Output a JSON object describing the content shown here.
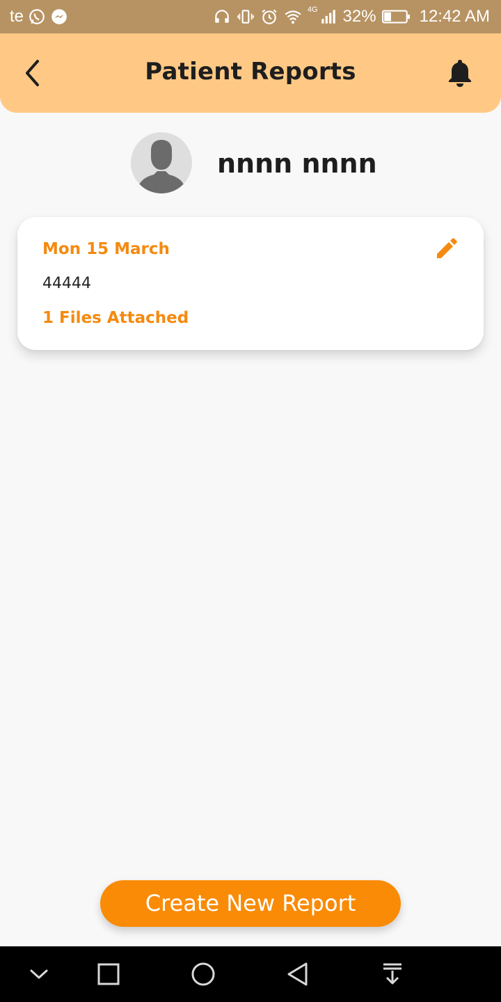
{
  "status_bar": {
    "carrier": "te",
    "network_type": "4G",
    "battery_percent": "32%",
    "battery_level": 0.32,
    "time": "12:42 AM",
    "left_icons": [
      "whatsapp-icon",
      "messenger-icon"
    ],
    "right_icons": [
      "headphones-icon",
      "vibrate-icon",
      "alarm-icon",
      "wifi-icon",
      "signal-icon",
      "battery-icon"
    ]
  },
  "header": {
    "title": "Patient Reports",
    "left_icon": "chevron-left-icon",
    "right_icon": "bell-icon",
    "background": "#ffc985"
  },
  "patient": {
    "name": "nnnn nnnn",
    "avatar_icon": "person-silhouette-icon"
  },
  "reports": [
    {
      "date": "Mon 15 March",
      "text": "44444",
      "files": "1 Files Attached",
      "action_icon": "pencil-edit-icon"
    }
  ],
  "actions": {
    "create_label": "Create New Report"
  },
  "colors": {
    "accent": "#f98b06",
    "accent_text": "#f48a0f",
    "status_bar": "#b79363",
    "page_background": "#f8f8f8"
  },
  "nav_bar": {
    "buttons": [
      "chevron-down-icon",
      "square-recents-icon",
      "circle-home-icon",
      "triangle-back-icon",
      "notification-pull-icon"
    ]
  }
}
